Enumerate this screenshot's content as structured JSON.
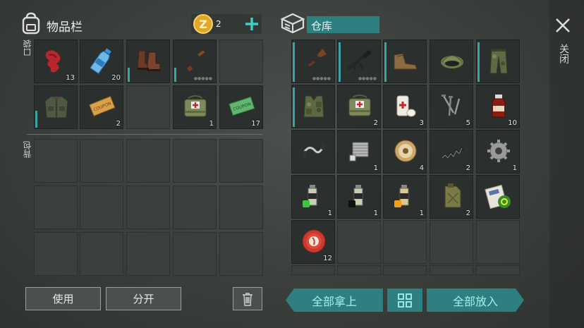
{
  "inventory": {
    "title": "物品栏",
    "coins": "2",
    "pockets_label": "口袋",
    "backpack_label": "背包",
    "pocket_items": [
      {
        "name": "red-cloth-icon",
        "count": "13"
      },
      {
        "name": "water-bottle-icon",
        "count": "20"
      },
      {
        "name": "leather-boots-icon",
        "count": ""
      },
      {
        "name": "rifle-icon",
        "count": ""
      },
      {
        "name": "empty",
        "count": ""
      },
      {
        "name": "jacket-icon",
        "count": ""
      },
      {
        "name": "coupon-icon",
        "count": "2"
      },
      {
        "name": "empty",
        "count": ""
      },
      {
        "name": "medic-bag-icon",
        "count": "1"
      },
      {
        "name": "ration-coupon-icon",
        "count": "17"
      }
    ]
  },
  "storage": {
    "title": "仓库",
    "items": [
      {
        "name": "shotgun-icon",
        "count": ""
      },
      {
        "name": "assault-rifle-icon",
        "count": ""
      },
      {
        "name": "boots-icon",
        "count": ""
      },
      {
        "name": "cap-icon",
        "count": ""
      },
      {
        "name": "camo-pants-icon",
        "count": ""
      },
      {
        "name": "camo-vest-icon",
        "count": ""
      },
      {
        "name": "medic-bag-icon",
        "count": "2"
      },
      {
        "name": "bandage-icon",
        "count": "3"
      },
      {
        "name": "nails-icon",
        "count": "5"
      },
      {
        "name": "medicine-bottle-icon",
        "count": "10"
      },
      {
        "name": "handlebar-icon",
        "count": ""
      },
      {
        "name": "engine-icon",
        "count": "1"
      },
      {
        "name": "wire-spool-icon",
        "count": "4"
      },
      {
        "name": "spring-icon",
        "count": "2"
      },
      {
        "name": "gear-icon",
        "count": "1"
      },
      {
        "name": "spray-green-icon",
        "count": "1"
      },
      {
        "name": "spray-black-icon",
        "count": "1"
      },
      {
        "name": "spray-yellow-icon",
        "count": "1"
      },
      {
        "name": "jerrycan-icon",
        "count": "2"
      },
      {
        "name": "biohazard-map-icon",
        "count": ""
      },
      {
        "name": "bottle-cap-icon",
        "count": "12"
      }
    ]
  },
  "buttons": {
    "use": "使用",
    "split": "分开",
    "take_all": "全部拿上",
    "put_all": "全部放入",
    "close": "关闭"
  },
  "colors": {
    "accent": "#2e7f80",
    "accent_text": "#9ff0ee",
    "coin": "#e0a72a",
    "plus": "#3ad1c8"
  }
}
